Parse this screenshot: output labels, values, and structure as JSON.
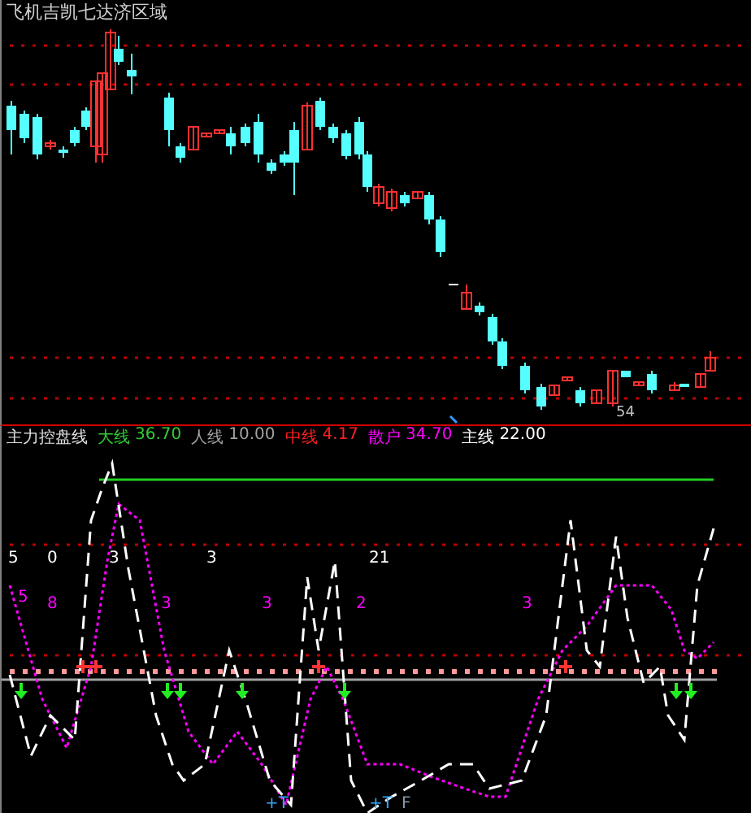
{
  "price_panel": {
    "title": "飞机吉凯七达济区域",
    "low_label": "54"
  },
  "indicator_panel": {
    "name": "主力控盘线",
    "legend": [
      {
        "label": "大线",
        "value": "36.70",
        "color": "#33cc33"
      },
      {
        "label": "人线",
        "value": "10.00",
        "color": "#a0a0a0"
      },
      {
        "label": "中线",
        "value": "4.17",
        "color": "#ff2020"
      },
      {
        "label": "散户",
        "value": "34.70",
        "color": "#ff00ff"
      },
      {
        "label": "主线",
        "value": "22.00",
        "color": "#ffffff"
      }
    ],
    "marks": [
      {
        "text": "5",
        "kind": "white"
      },
      {
        "text": "0",
        "kind": "white"
      },
      {
        "text": "3",
        "kind": "white"
      },
      {
        "text": "3",
        "kind": "white"
      },
      {
        "text": "21",
        "kind": "white"
      },
      {
        "text": "5",
        "kind": "magenta"
      },
      {
        "text": "8",
        "kind": "magenta"
      },
      {
        "text": "3",
        "kind": "magenta"
      },
      {
        "text": "3",
        "kind": "magenta"
      },
      {
        "text": "2",
        "kind": "magenta"
      },
      {
        "text": "3",
        "kind": "magenta"
      },
      {
        "text": "+T",
        "kind": "cyan"
      },
      {
        "text": "+T",
        "kind": "cyan"
      },
      {
        "text": "F",
        "kind": "gray"
      }
    ]
  }
}
